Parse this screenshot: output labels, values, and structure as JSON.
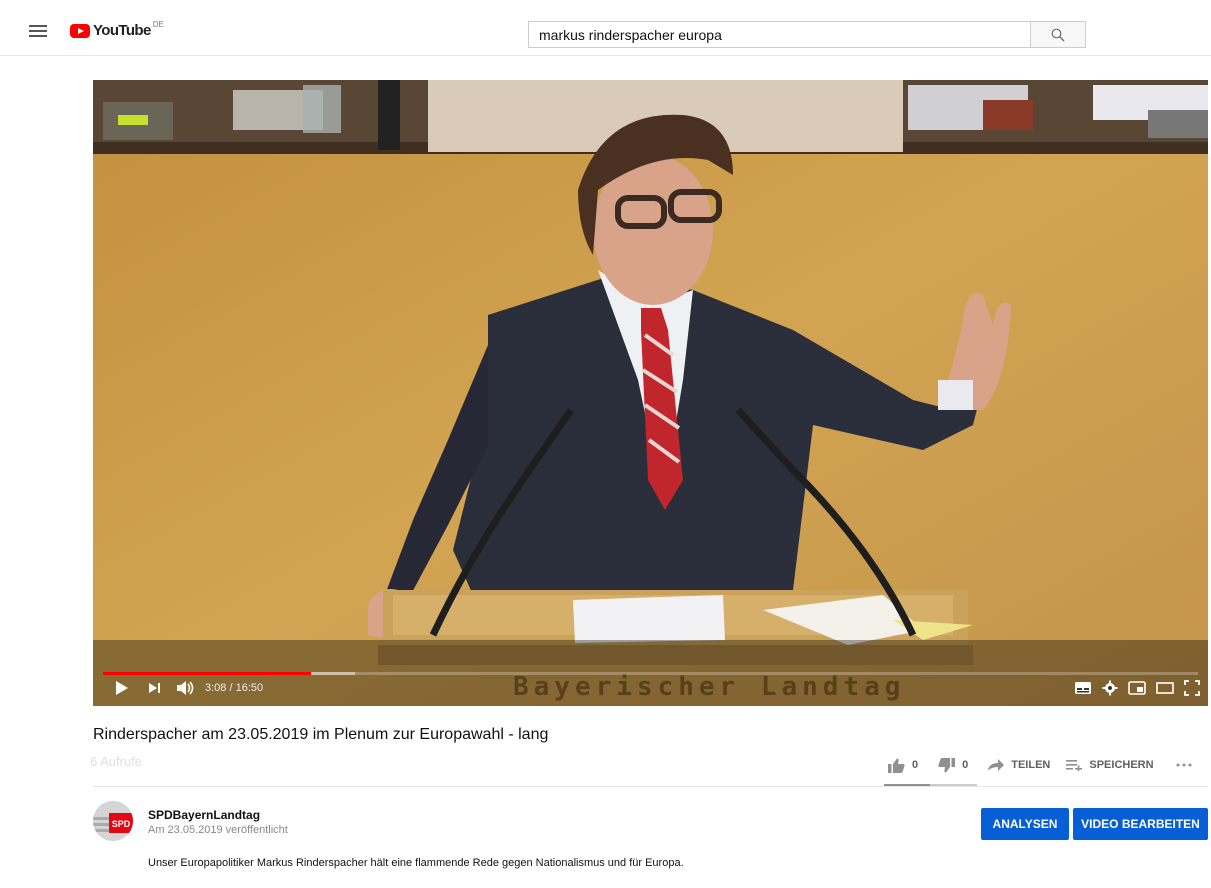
{
  "header": {
    "logo_text": "YouTube",
    "logo_region": "DE",
    "search_value": "markus rinderspacher europa"
  },
  "player": {
    "time_display": "3:08 / 16:50",
    "watermark": "Bayerischer Landtag",
    "progress": {
      "played_fraction": 0.19,
      "buffered_fraction": 0.23
    }
  },
  "video": {
    "title": "Rinderspacher am 23.05.2019 im Plenum zur Europawahl - lang",
    "views": "6 Aufrufe",
    "likes": "0",
    "dislikes": "0",
    "share_label": "TEILEN",
    "save_label": "SPEICHERN"
  },
  "channel": {
    "name": "SPDBayernLandtag",
    "published": "Am 23.05.2019 veröffentlicht",
    "avatar_badge": "SPD",
    "analytics_label": "ANALYSEN",
    "edit_label": "VIDEO BEARBEITEN"
  },
  "description": "Unser Europapolitiker Markus Rinderspacher hält eine flammende Rede gegen Nationalismus und für Europa.",
  "colors": {
    "youtube_red": "#ff0000",
    "button_blue": "#065fd4"
  }
}
